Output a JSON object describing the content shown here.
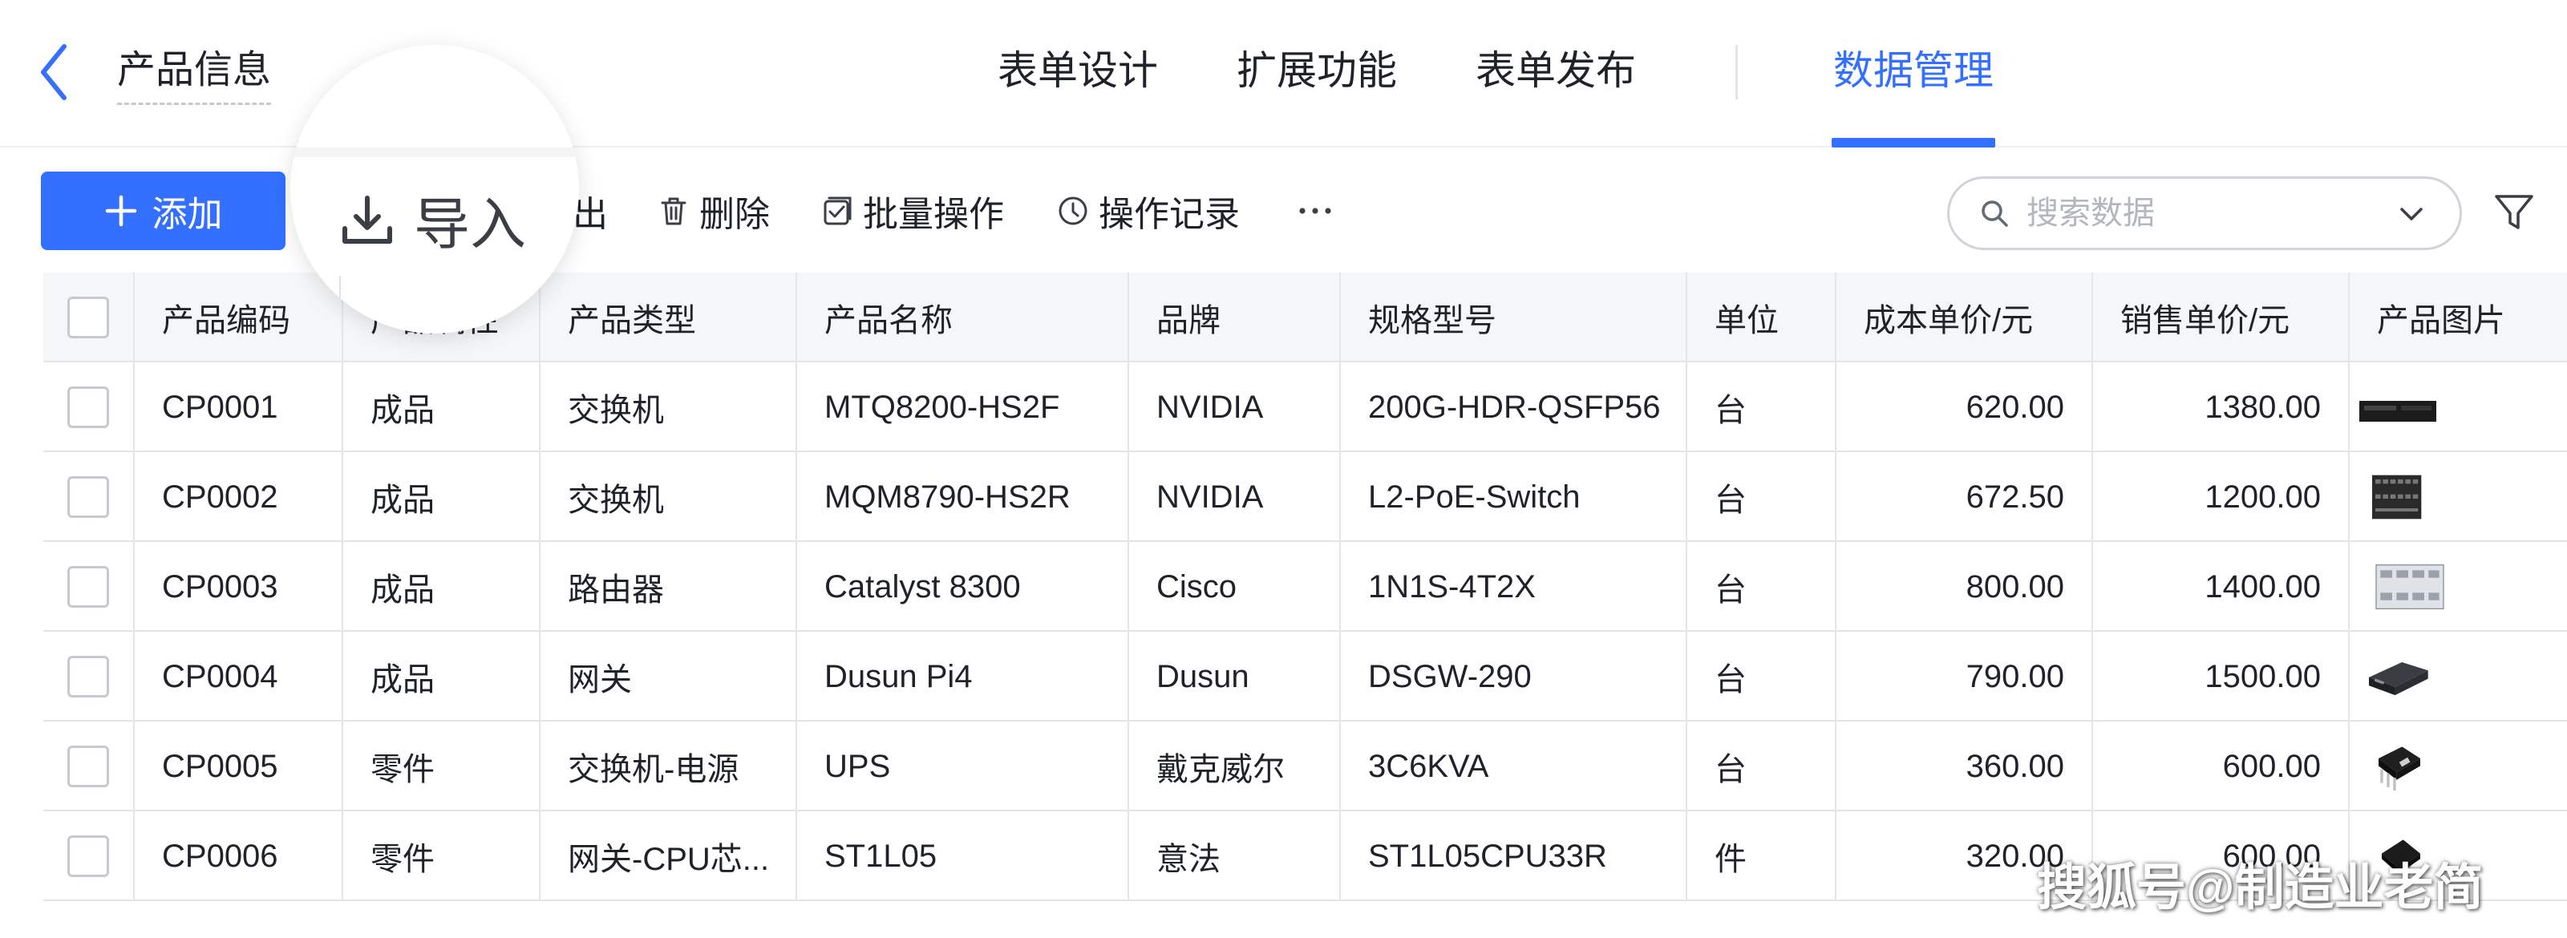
{
  "header": {
    "title": "产品信息",
    "nav_tabs": [
      {
        "label": "表单设计"
      },
      {
        "label": "扩展功能"
      },
      {
        "label": "表单发布"
      },
      {
        "label": "数据管理",
        "active": true
      }
    ]
  },
  "toolbar": {
    "add_label": "添加",
    "import_label": "导入",
    "export_label": "出",
    "delete_label": "删除",
    "batch_label": "批量操作",
    "history_label": "操作记录",
    "more_label": "···",
    "search_placeholder": "搜索数据"
  },
  "table": {
    "columns": [
      "产品编码",
      "产品属性",
      "产品类型",
      "产品名称",
      "品牌",
      "规格型号",
      "单位",
      "成本单价/元",
      "销售单价/元",
      "产品图片"
    ],
    "rows": [
      {
        "code": "CP0001",
        "attr": "成品",
        "type": "交换机",
        "name": "MTQ8200-HS2F",
        "brand": "NVIDIA",
        "spec": "200G-HDR-QSFP56",
        "unit": "台",
        "cost": "620.00",
        "price": "1380.00",
        "image": "switch-1u-image"
      },
      {
        "code": "CP0002",
        "attr": "成品",
        "type": "交换机",
        "name": "MQM8790-HS2R",
        "brand": "NVIDIA",
        "spec": "L2-PoE-Switch",
        "unit": "台",
        "cost": "672.50",
        "price": "1200.00",
        "image": "switch-front-panel-image"
      },
      {
        "code": "CP0003",
        "attr": "成品",
        "type": "路由器",
        "name": "Catalyst 8300",
        "brand": "Cisco",
        "spec": "1N1S-4T2X",
        "unit": "台",
        "cost": "800.00",
        "price": "1400.00",
        "image": "router-image"
      },
      {
        "code": "CP0004",
        "attr": "成品",
        "type": "网关",
        "name": "Dusun Pi4",
        "brand": "Dusun",
        "spec": "DSGW-290",
        "unit": "台",
        "cost": "790.00",
        "price": "1500.00",
        "image": "gateway-box-image"
      },
      {
        "code": "CP0005",
        "attr": "零件",
        "type": "交换机-电源",
        "name": "UPS",
        "brand": "戴克威尔",
        "spec": "3C6KVA",
        "unit": "台",
        "cost": "360.00",
        "price": "600.00",
        "image": "power-chip-image"
      },
      {
        "code": "CP0006",
        "attr": "零件",
        "type": "网关-CPU芯...",
        "name": "ST1L05",
        "brand": "意法",
        "spec": "ST1L05CPU33R",
        "unit": "件",
        "cost": "320.00",
        "price": "600.00",
        "image": "cpu-chip-image"
      }
    ]
  },
  "watermark": "搜狐号@制造业老简",
  "colors": {
    "accent": "#3370ff",
    "border": "#e3e5e8",
    "header_bg": "#f5f6f7"
  }
}
